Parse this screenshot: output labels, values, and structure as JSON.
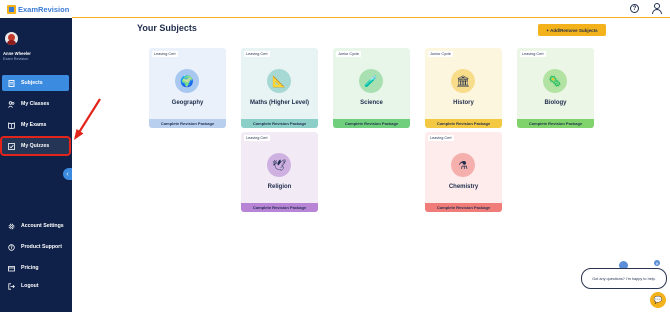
{
  "app": {
    "logo_text": "ExamRevision",
    "logo_icon": "book-logo-icon"
  },
  "user": {
    "name": "Anne Wheeler",
    "role": "Exam Revision"
  },
  "sidebar": {
    "items": [
      {
        "label": "Subjects",
        "icon": "document-icon",
        "active": true
      },
      {
        "label": "My Classes",
        "icon": "users-icon"
      },
      {
        "label": "My Exams",
        "icon": "book-icon"
      },
      {
        "label": "My Quizzes",
        "icon": "checkbox-icon",
        "highlighted": true
      },
      {
        "label": "Account Settings",
        "icon": "gear-icon"
      },
      {
        "label": "Product Support",
        "icon": "help-circle-icon"
      },
      {
        "label": "Pricing",
        "icon": "card-icon"
      },
      {
        "label": "Logout",
        "icon": "logout-icon"
      }
    ]
  },
  "header": {
    "help_icon": "help-circle-icon",
    "profile_icon": "profile-icon"
  },
  "main": {
    "title": "Your Subjects",
    "add_button_label": "+ Add/Remove Subjects",
    "cards": [
      {
        "level": "Leaving Cert",
        "subject": "Geography",
        "package": "Complete Revision Package",
        "icon": "globe-icon",
        "bg": "#eaf1fb",
        "circle": "#a9c8ef",
        "footer": "#b8cfee"
      },
      {
        "level": "Leaving Cert",
        "subject": "Maths (Higher Level)",
        "package": "Complete Revision Package",
        "icon": "ruler-icon",
        "bg": "#e7f4f3",
        "circle": "#a6d9d4",
        "footer": "#8ccfc8"
      },
      {
        "level": "Junior Cycle",
        "subject": "Science",
        "package": "Complete Revision Package",
        "icon": "flask-icon",
        "bg": "#e8f6ea",
        "circle": "#a9e0b1",
        "footer": "#6fcf7c"
      },
      {
        "level": "Junior Cycle",
        "subject": "History",
        "package": "Complete Revision Package",
        "icon": "column-icon",
        "bg": "#fdf6df",
        "circle": "#f7dd8a",
        "footer": "#f3c843"
      },
      {
        "level": "Leaving Cert",
        "subject": "Biology",
        "package": "Complete Revision Package",
        "icon": "cell-icon",
        "bg": "#ebf6e6",
        "circle": "#b3e3a3",
        "footer": "#7fd36a"
      },
      {
        "level": "Leaving Cert",
        "subject": "Religion",
        "package": "Complete Revision Package",
        "icon": "dove-icon",
        "bg": "#f2ebf6",
        "circle": "#cfb1e1",
        "footer": "#b784d6"
      },
      {
        "level": "Leaving Cert",
        "subject": "Chemistry",
        "package": "Complete Revision Package",
        "icon": "beaker-icon",
        "bg": "#fdeceb",
        "circle": "#f5b0ae",
        "footer": "#f07c7a"
      }
    ]
  },
  "chat": {
    "message": "Got any questions? I'm happy to help.",
    "close_icon": "close-icon",
    "launcher_icon": "chat-icon"
  },
  "colors": {
    "sidebar_bg": "#0f2149",
    "accent": "#3b8be0",
    "brand_yellow": "#f3b21b",
    "annotation_red": "#e3241b"
  }
}
